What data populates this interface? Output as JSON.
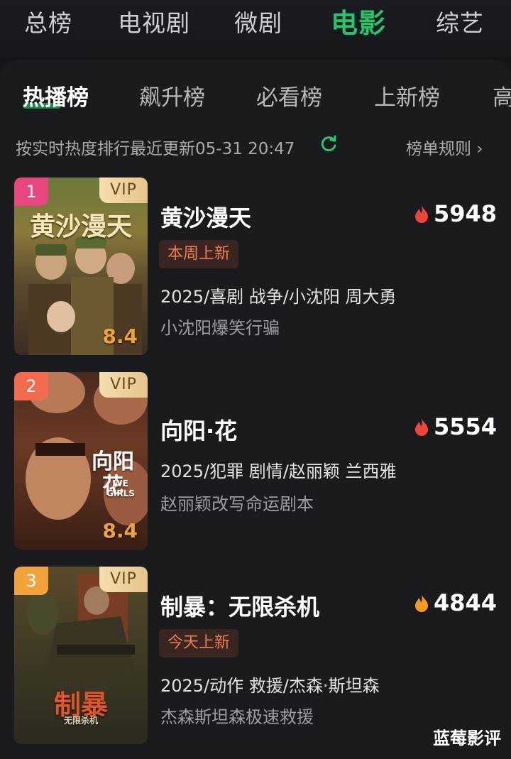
{
  "top_tabs": [
    "总榜",
    "电视剧",
    "微剧",
    "电影",
    "综艺"
  ],
  "active_top_tab": "电影",
  "sub_tabs": [
    "热播榜",
    "飙升榜",
    "必看榜",
    "上新榜",
    "高"
  ],
  "update": {
    "text": "按实时热度排行最近更新05-31 20:47",
    "rules": "榜单规则 ›"
  },
  "colors": {
    "accent": "#27c46a",
    "flame_hot": "#f0463a",
    "flame_warm": "#f59a1c"
  },
  "items": [
    {
      "rank": "1",
      "vip": "VIP",
      "score": "8.4",
      "poster_title": "黄沙漫天",
      "title": "黄沙漫天",
      "heat": "5948",
      "badge": "本周上新",
      "meta": "2025/喜剧 战争/小沈阳 周大勇",
      "tagline": "小沈阳爆笑行骗"
    },
    {
      "rank": "2",
      "vip": "VIP",
      "score": "8.4",
      "poster_title": "向阳花",
      "poster_subtitle": "WE GIRLS",
      "title": "向阳·花",
      "heat": "5554",
      "meta": "2025/犯罪 剧情/赵丽颖 兰西雅",
      "tagline": "赵丽颖改写命运剧本"
    },
    {
      "rank": "3",
      "vip": "VIP",
      "poster_title": "制暴",
      "poster_subtitle": "无限杀机",
      "title": "制暴：无限杀机",
      "heat": "4844",
      "badge": "今天上新",
      "meta": "2025/动作 救援/杰森·斯坦森",
      "tagline": "杰森斯坦森极速救援"
    }
  ],
  "watermark": "蓝莓影评"
}
